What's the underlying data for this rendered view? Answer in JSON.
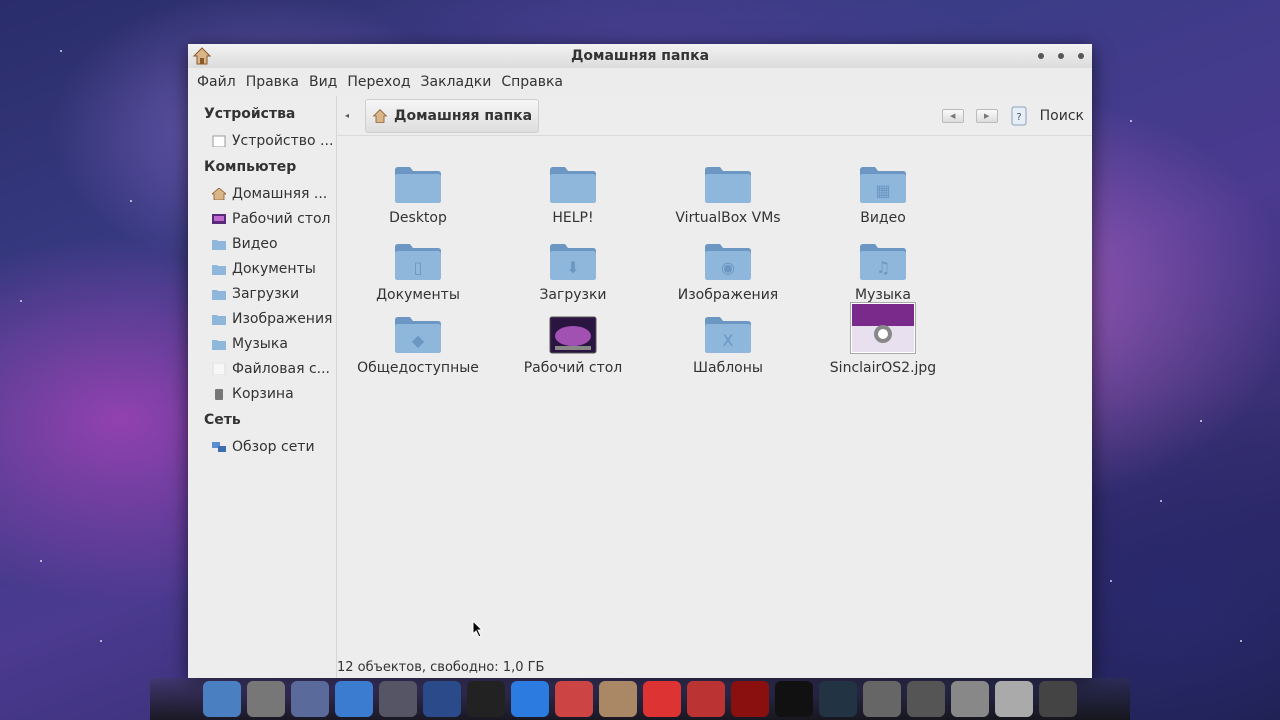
{
  "window": {
    "title": "Домашняя папка"
  },
  "menu": [
    "Файл",
    "Правка",
    "Вид",
    "Переход",
    "Закладки",
    "Справка"
  ],
  "sidebar": {
    "sections": [
      {
        "title": "Устройства",
        "items": [
          {
            "label": "Устройство ...",
            "icon": "drive-icon"
          }
        ]
      },
      {
        "title": "Компьютер",
        "items": [
          {
            "label": "Домашняя ...",
            "icon": "home-icon"
          },
          {
            "label": "Рабочий стол",
            "icon": "desktop-icon"
          },
          {
            "label": "Видео",
            "icon": "folder-icon"
          },
          {
            "label": "Документы",
            "icon": "folder-icon"
          },
          {
            "label": "Загрузки",
            "icon": "folder-icon"
          },
          {
            "label": "Изображения",
            "icon": "folder-icon"
          },
          {
            "label": "Музыка",
            "icon": "folder-icon"
          },
          {
            "label": "Файловая с...",
            "icon": "filesystem-icon"
          },
          {
            "label": "Корзина",
            "icon": "trash-icon"
          }
        ]
      },
      {
        "title": "Сеть",
        "items": [
          {
            "label": "Обзор сети",
            "icon": "network-icon"
          }
        ]
      }
    ]
  },
  "location": {
    "crumb": "Домашняя папка",
    "search_label": "Поиск"
  },
  "files": [
    {
      "name": "Desktop",
      "icon": "folder-icon",
      "glyph": ""
    },
    {
      "name": "HELP!",
      "icon": "folder-icon",
      "glyph": ""
    },
    {
      "name": "VirtualBox VMs",
      "icon": "folder-icon",
      "glyph": ""
    },
    {
      "name": "Видео",
      "icon": "video-folder-icon",
      "glyph": "▦"
    },
    {
      "name": "Документы",
      "icon": "documents-folder-icon",
      "glyph": "▯"
    },
    {
      "name": "Загрузки",
      "icon": "downloads-folder-icon",
      "glyph": "⬇"
    },
    {
      "name": "Изображения",
      "icon": "pictures-folder-icon",
      "glyph": "◉"
    },
    {
      "name": "Музыка",
      "icon": "music-folder-icon",
      "glyph": "♫"
    },
    {
      "name": "Общедоступные",
      "icon": "public-folder-icon",
      "glyph": "◆"
    },
    {
      "name": "Рабочий стол",
      "icon": "desktop-folder-icon",
      "glyph": ""
    },
    {
      "name": "Шаблоны",
      "icon": "templates-folder-icon",
      "glyph": "X"
    },
    {
      "name": "SinclairOS2.jpg",
      "icon": "image-thumbnail-icon",
      "glyph": ""
    }
  ],
  "status": "12 объектов, свободно: 1,0 ГБ",
  "colors": {
    "folder": "#8fb6db",
    "folder_dark": "#6c97c2",
    "window_bg": "#ececec"
  }
}
